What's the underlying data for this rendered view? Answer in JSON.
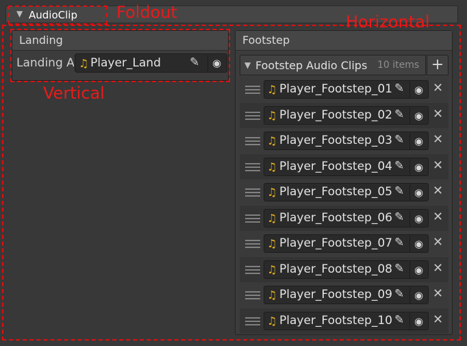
{
  "foldout": {
    "title": "AudioClip"
  },
  "annotations": {
    "foldout": "Foldout",
    "horizontal": "Horizontal",
    "vertical": "Vertical"
  },
  "landing": {
    "header": "Landing",
    "field_label": "Landing A",
    "field_value": "Player_Land"
  },
  "footstep": {
    "header": "Footstep",
    "list_title": "Footstep Audio Clips",
    "count": "10 items",
    "add_symbol": "+",
    "items": [
      "Player_Footstep_01",
      "Player_Footstep_02",
      "Player_Footstep_03",
      "Player_Footstep_04",
      "Player_Footstep_05",
      "Player_Footstep_06",
      "Player_Footstep_07",
      "Player_Footstep_08",
      "Player_Footstep_09",
      "Player_Footstep_10"
    ]
  },
  "icons": {
    "foldout_arrow": "triangle-down-icon",
    "audio": "music-note-icon",
    "edit": "pencil-icon",
    "picker": "target-icon",
    "remove": "close-icon",
    "drag": "drag-handle-icon"
  },
  "colors": {
    "annotation": "#e01010",
    "audio_icon": "#e9b21c"
  }
}
